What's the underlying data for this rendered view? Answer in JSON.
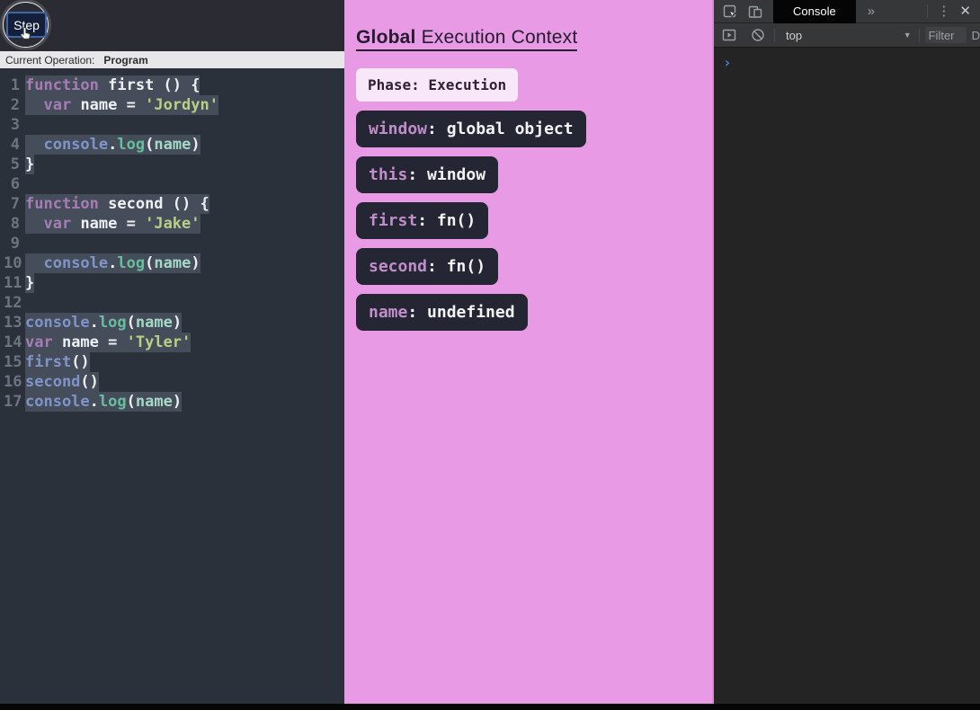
{
  "stepper": {
    "step_label": "Step"
  },
  "current_operation": {
    "label": "Current Operation:",
    "value": "Program"
  },
  "editor": {
    "lines": [
      {
        "num": 1,
        "highlight": true,
        "tokens": [
          {
            "c": "kw",
            "t": "function"
          },
          {
            "c": "pl",
            "t": " first () {"
          }
        ]
      },
      {
        "num": 2,
        "highlight": true,
        "tokens": [
          {
            "c": "pl",
            "t": "  "
          },
          {
            "c": "kw",
            "t": "var"
          },
          {
            "c": "pl",
            "t": " name = "
          },
          {
            "c": "str",
            "t": "'Jordyn'"
          }
        ]
      },
      {
        "num": 3,
        "highlight": false,
        "tokens": []
      },
      {
        "num": 4,
        "highlight": true,
        "tokens": [
          {
            "c": "pl",
            "t": "  "
          },
          {
            "c": "obj",
            "t": "console"
          },
          {
            "c": "pl",
            "t": "."
          },
          {
            "c": "met",
            "t": "log"
          },
          {
            "c": "pl",
            "t": "("
          },
          {
            "c": "arg",
            "t": "name"
          },
          {
            "c": "pl",
            "t": ")"
          }
        ]
      },
      {
        "num": 5,
        "highlight": true,
        "tokens": [
          {
            "c": "pl",
            "t": "}"
          }
        ]
      },
      {
        "num": 6,
        "highlight": false,
        "tokens": []
      },
      {
        "num": 7,
        "highlight": true,
        "tokens": [
          {
            "c": "kw",
            "t": "function"
          },
          {
            "c": "pl",
            "t": " second () {"
          }
        ]
      },
      {
        "num": 8,
        "highlight": true,
        "tokens": [
          {
            "c": "pl",
            "t": "  "
          },
          {
            "c": "kw",
            "t": "var"
          },
          {
            "c": "pl",
            "t": " name = "
          },
          {
            "c": "str",
            "t": "'Jake'"
          }
        ]
      },
      {
        "num": 9,
        "highlight": false,
        "tokens": []
      },
      {
        "num": 10,
        "highlight": true,
        "tokens": [
          {
            "c": "pl",
            "t": "  "
          },
          {
            "c": "obj",
            "t": "console"
          },
          {
            "c": "pl",
            "t": "."
          },
          {
            "c": "met",
            "t": "log"
          },
          {
            "c": "pl",
            "t": "("
          },
          {
            "c": "arg",
            "t": "name"
          },
          {
            "c": "pl",
            "t": ")"
          }
        ]
      },
      {
        "num": 11,
        "highlight": true,
        "tokens": [
          {
            "c": "pl",
            "t": "}"
          }
        ]
      },
      {
        "num": 12,
        "highlight": false,
        "tokens": []
      },
      {
        "num": 13,
        "highlight": true,
        "tokens": [
          {
            "c": "obj",
            "t": "console"
          },
          {
            "c": "pl",
            "t": "."
          },
          {
            "c": "met",
            "t": "log"
          },
          {
            "c": "pl",
            "t": "("
          },
          {
            "c": "arg",
            "t": "name"
          },
          {
            "c": "pl",
            "t": ")"
          }
        ]
      },
      {
        "num": 14,
        "highlight": true,
        "tokens": [
          {
            "c": "kw",
            "t": "var"
          },
          {
            "c": "pl",
            "t": " name = "
          },
          {
            "c": "str",
            "t": "'Tyler'"
          }
        ]
      },
      {
        "num": 15,
        "highlight": true,
        "tokens": [
          {
            "c": "obj",
            "t": "first"
          },
          {
            "c": "pl",
            "t": "()"
          }
        ]
      },
      {
        "num": 16,
        "highlight": true,
        "tokens": [
          {
            "c": "obj",
            "t": "second"
          },
          {
            "c": "pl",
            "t": "()"
          }
        ]
      },
      {
        "num": 17,
        "highlight": true,
        "tokens": [
          {
            "c": "obj",
            "t": "console"
          },
          {
            "c": "pl",
            "t": "."
          },
          {
            "c": "met",
            "t": "log"
          },
          {
            "c": "pl",
            "t": "("
          },
          {
            "c": "arg",
            "t": "name"
          },
          {
            "c": "pl",
            "t": ")"
          }
        ]
      }
    ]
  },
  "context_panel": {
    "title_bold": "Global",
    "title_rest": " Execution Context",
    "phase_label": "Phase:",
    "phase_value": " Execution",
    "variables": [
      {
        "key": "window",
        "value": "global object"
      },
      {
        "key": "this",
        "value": "window"
      },
      {
        "key": "first",
        "value": "fn()"
      },
      {
        "key": "second",
        "value": "fn()"
      },
      {
        "key": "name",
        "value": "undefined"
      }
    ]
  },
  "devtools": {
    "tab_label": "Console",
    "context_selector": "top",
    "filter_placeholder": "Filter",
    "levels_partial": "D",
    "icons": {
      "more_tabs": "»",
      "menu": "⋮",
      "close": "✕",
      "dropdown_arrow": "▼",
      "prompt": "›"
    }
  },
  "colors": {
    "panel_pink": "#e89ae5",
    "phase_badge_bg": "#f8e7f8",
    "variable_badge_bg": "#242633",
    "variable_key": "#c18ecb",
    "code_highlight": "#454d5a",
    "prompt_blue": "#4a7de2"
  }
}
